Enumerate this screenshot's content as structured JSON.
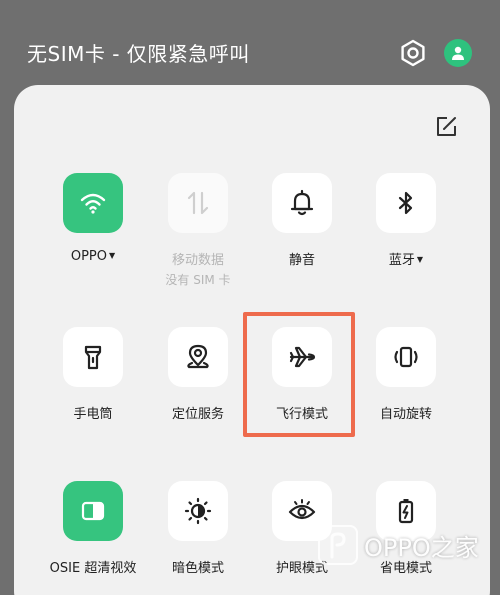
{
  "status_bar": {
    "carrier_text": "无SIM卡 - 仅限紧急呼叫",
    "settings_icon": "gear-hexagon-icon",
    "user_icon": "user-icon"
  },
  "panel": {
    "edit_icon": "edit-icon",
    "tiles": [
      {
        "label": "OPPO",
        "icon": "wifi-icon",
        "state": "on",
        "has_caret": true
      },
      {
        "label": "移动数据",
        "sublabel": "没有 SIM 卡",
        "icon": "mobile-data-icon",
        "state": "disabled"
      },
      {
        "label": "静音",
        "icon": "bell-icon",
        "state": "off"
      },
      {
        "label": "蓝牙",
        "icon": "bluetooth-icon",
        "state": "off",
        "has_caret": true
      },
      {
        "label": "手电筒",
        "icon": "flashlight-icon",
        "state": "off"
      },
      {
        "label": "定位服务",
        "icon": "location-icon",
        "state": "off"
      },
      {
        "label": "飞行模式",
        "icon": "airplane-icon",
        "state": "off",
        "highlighted": true
      },
      {
        "label": "自动旋转",
        "icon": "rotate-icon",
        "state": "off"
      },
      {
        "label": "OSIE 超清视效",
        "icon": "osie-icon",
        "state": "on"
      },
      {
        "label": "暗色模式",
        "icon": "dark-mode-icon",
        "state": "off"
      },
      {
        "label": "护眼模式",
        "icon": "eye-icon",
        "state": "off"
      },
      {
        "label": "省电模式",
        "icon": "battery-saver-icon",
        "state": "off"
      }
    ]
  },
  "watermark": {
    "text": "OPPO之家"
  },
  "colors": {
    "accent_green": "#36c47f",
    "highlight_orange": "#ee6b4d",
    "panel_bg": "#f1f1f1",
    "backdrop": "#6f6f6f"
  }
}
